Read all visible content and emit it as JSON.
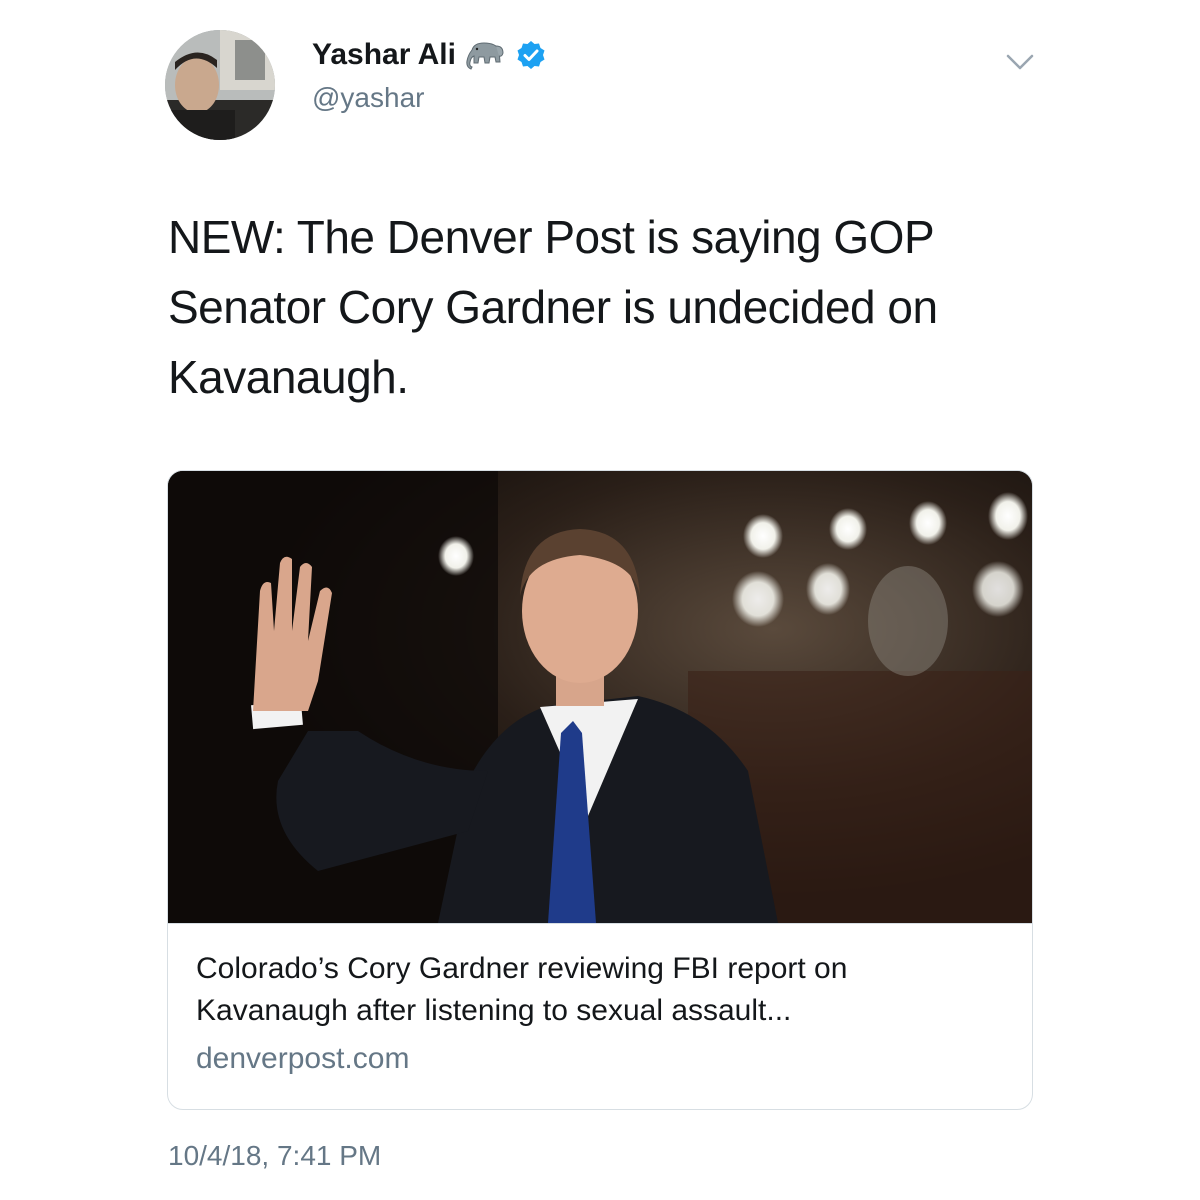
{
  "author": {
    "display_name": "Yashar Ali",
    "handle": "@yashar",
    "emoji": "elephant-emoji",
    "verified": true
  },
  "tweet": {
    "text_lines": [
      "NEW: The Denver Post is saying GOP",
      "Senator Cory Gardner is undecided on",
      "Kavanaugh."
    ],
    "timestamp": "10/4/18, 7:41 PM"
  },
  "card": {
    "title_lines": [
      "Colorado’s Cory Gardner reviewing FBI report on",
      "Kavanaugh after listening to sexual assault..."
    ],
    "domain": "denverpost.com"
  },
  "icons": {
    "menu": "chevron-down-icon",
    "verified": "verified-badge-icon"
  },
  "colors": {
    "text_primary": "#14171a",
    "text_secondary": "#657786",
    "verified_blue": "#1da1f2",
    "card_border": "#d7dee3"
  }
}
